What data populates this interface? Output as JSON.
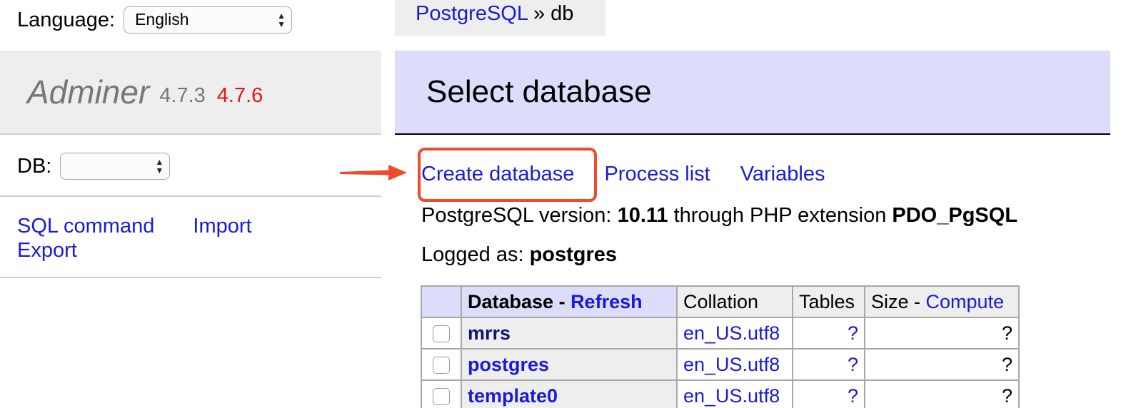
{
  "sidebar": {
    "language_label": "Language:",
    "language_value": "English",
    "brand": {
      "name": "Adminer",
      "version": "4.7.3",
      "new_version": "4.7.6"
    },
    "db_label": "DB:",
    "db_value": "",
    "links": {
      "sql_command": "SQL command",
      "import": "Import",
      "export": "Export"
    }
  },
  "breadcrumb": {
    "link": "PostgreSQL",
    "separator": " » ",
    "current": "db"
  },
  "main": {
    "title": "Select database",
    "actions": {
      "create_database": "Create database",
      "process_list": "Process list",
      "variables": "Variables"
    },
    "version_info": {
      "prefix": "PostgreSQL version: ",
      "version": "10.11",
      "middle": " through PHP extension ",
      "extension": "PDO_PgSQL"
    },
    "logged_info": {
      "prefix": "Logged as: ",
      "user": "postgres"
    }
  },
  "table": {
    "headers": {
      "database": "Database - ",
      "refresh": "Refresh",
      "collation": "Collation",
      "tables": "Tables",
      "size": "Size - ",
      "compute": "Compute"
    },
    "rows": [
      {
        "name": "mrrs",
        "collation": "en_US.utf8",
        "tables": "?",
        "size": "?"
      },
      {
        "name": "postgres",
        "collation": "en_US.utf8",
        "tables": "?",
        "size": "?"
      },
      {
        "name": "template0",
        "collation": "en_US.utf8",
        "tables": "?",
        "size": "?"
      }
    ]
  },
  "colors": {
    "link": "#1a1ad9",
    "highlight": "#ee4a2c",
    "header_bg": "#dcdcfb",
    "new_version": "#e8121c"
  },
  "icons": {
    "annotation": "arrow-right-icon",
    "select": "select-arrows-icon",
    "checkbox": "checkbox-icon"
  }
}
